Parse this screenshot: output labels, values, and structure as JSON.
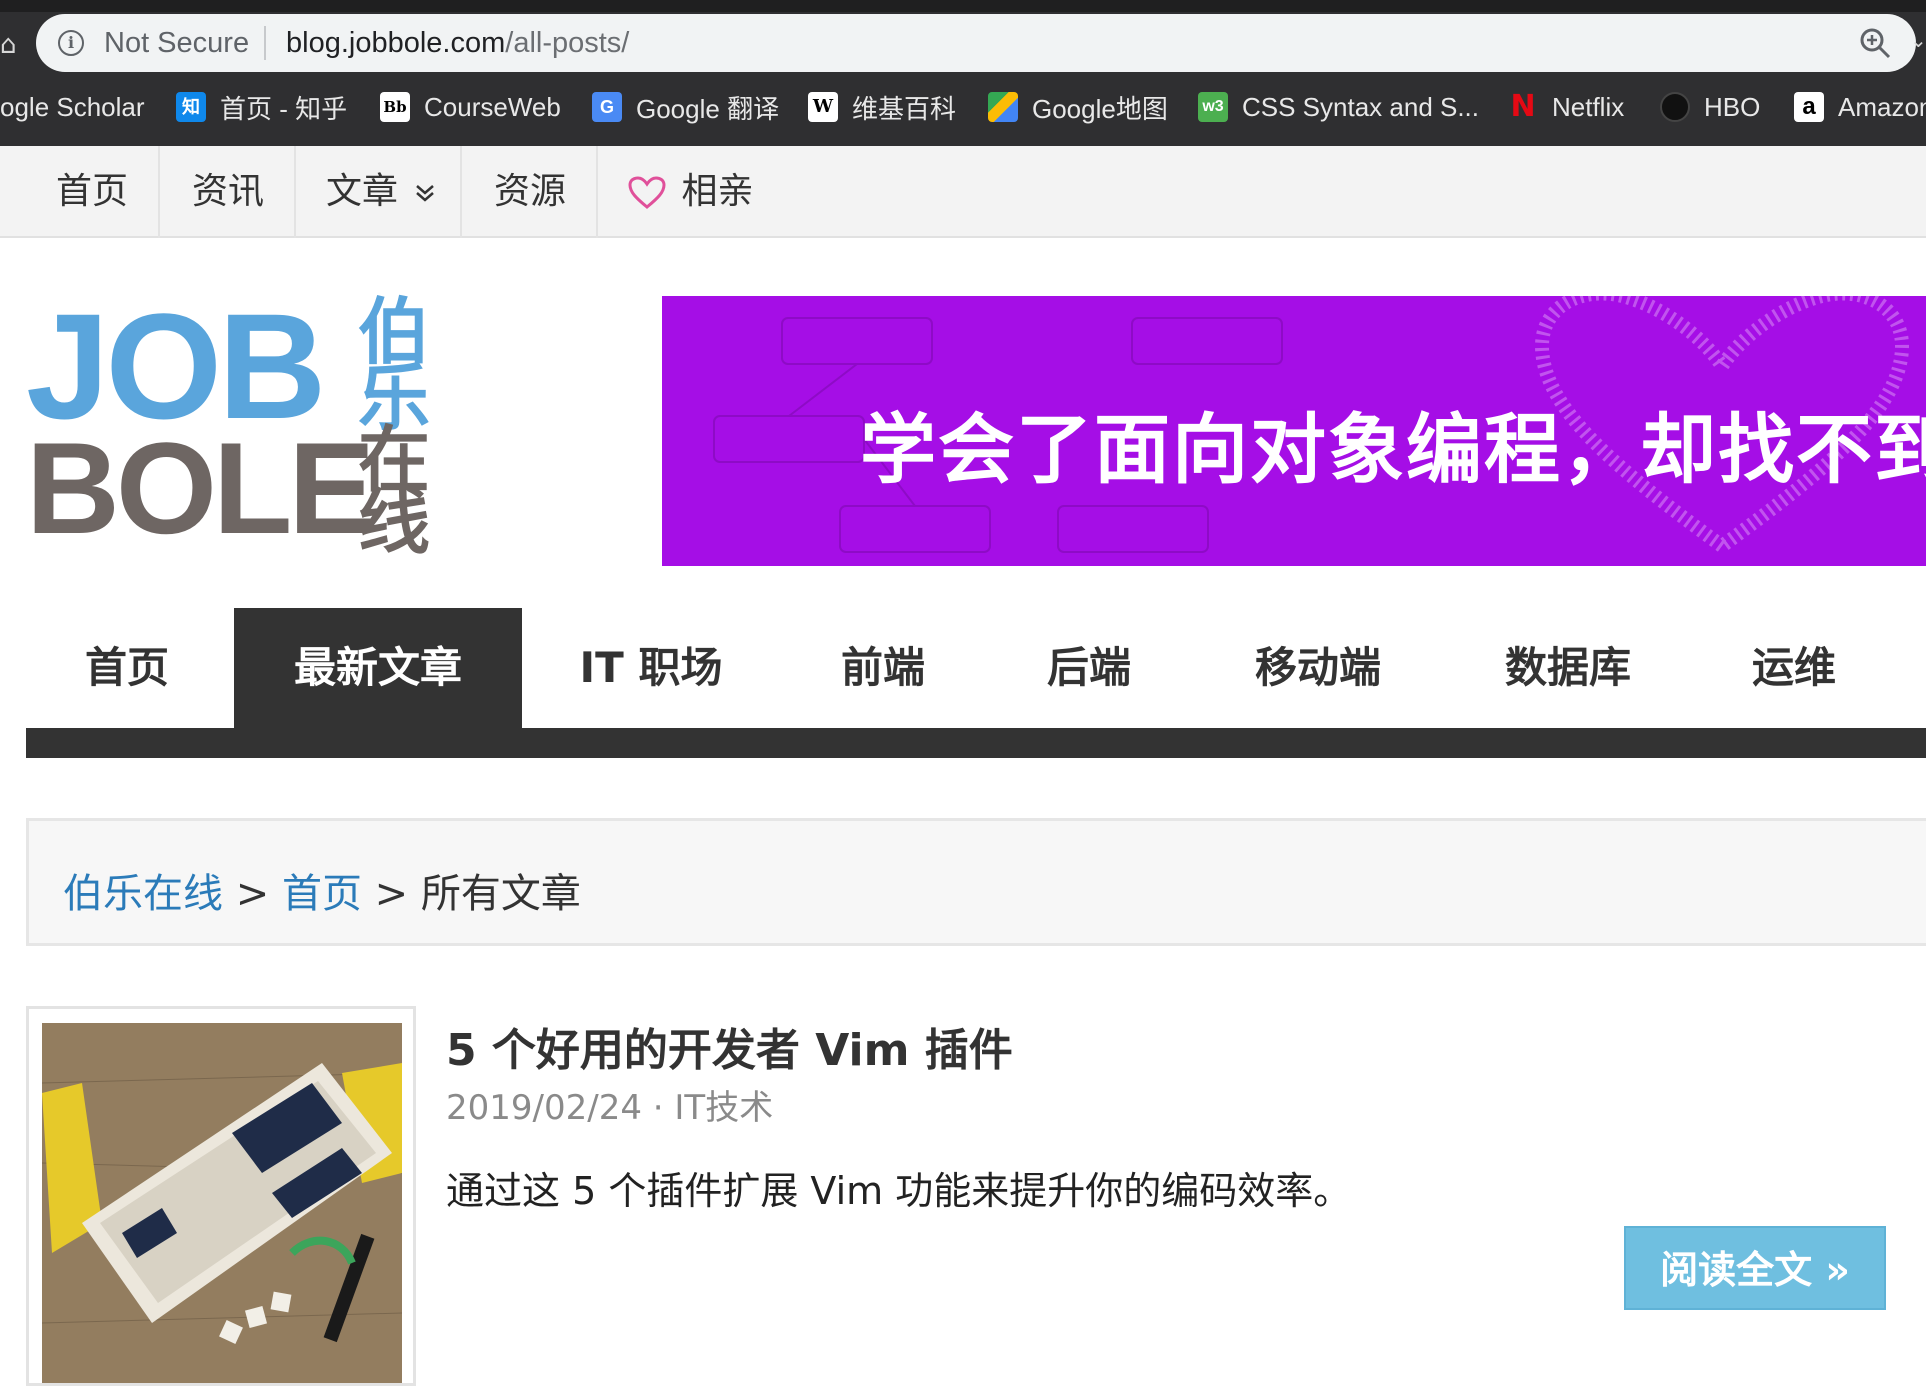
{
  "browser": {
    "not_secure": "Not Secure",
    "url_host": "blog.jobbole.com",
    "url_path": "/all-posts/",
    "bookmarks": [
      {
        "label": "ogle Scholar",
        "icon": "none"
      },
      {
        "label": "首页 - 知乎",
        "icon": "zhihu-icon",
        "glyph": "知"
      },
      {
        "label": "CourseWeb",
        "icon": "blackboard-icon",
        "glyph": "Bb"
      },
      {
        "label": "Google 翻译",
        "icon": "google-translate-icon",
        "glyph": "G"
      },
      {
        "label": "维基百科",
        "icon": "wikipedia-icon",
        "glyph": "W"
      },
      {
        "label": "Google地图",
        "icon": "google-maps-icon",
        "glyph": ""
      },
      {
        "label": "CSS Syntax and S...",
        "icon": "w3schools-icon",
        "glyph": "w3"
      },
      {
        "label": "Netflix",
        "icon": "netflix-icon",
        "glyph": "N"
      },
      {
        "label": "HBO",
        "icon": "hbo-icon",
        "glyph": ""
      },
      {
        "label": "Amazon",
        "icon": "amazon-icon",
        "glyph": "a"
      }
    ]
  },
  "topnav": {
    "items": [
      "首页",
      "资讯",
      "文章",
      "资源",
      "相亲"
    ]
  },
  "logo": {
    "line1": "JOB",
    "line2": "BOLE",
    "cn": [
      "伯",
      "乐",
      "在",
      "线"
    ]
  },
  "banner": {
    "text": "学会了面向对象编程，却找不到对象"
  },
  "mainnav": {
    "items": [
      "首页",
      "最新文章",
      "IT 职场",
      "前端",
      "后端",
      "移动端",
      "数据库",
      "运维"
    ],
    "active_index": 1
  },
  "breadcrumb": {
    "site": "伯乐在线",
    "sep": ">",
    "home": "首页",
    "current": "所有文章"
  },
  "post": {
    "title": "5 个好用的开发者 Vim 插件",
    "date": "2019/02/24",
    "meta_sep": "·",
    "category": "IT技术",
    "excerpt": "通过这 5 个插件扩展 Vim 功能来提升你的编码效率。",
    "read_more": "阅读全文 »"
  },
  "colors": {
    "chrome_bg": "#2f2f31",
    "banner_purple": "#a50ee6",
    "logo_blue": "#5aa5dc",
    "logo_gray": "#6e6663",
    "nav_dark": "#333333",
    "link_blue": "#2b7bb9",
    "read_more_blue": "#6fbfe0",
    "heart_pink": "#e0509a"
  }
}
